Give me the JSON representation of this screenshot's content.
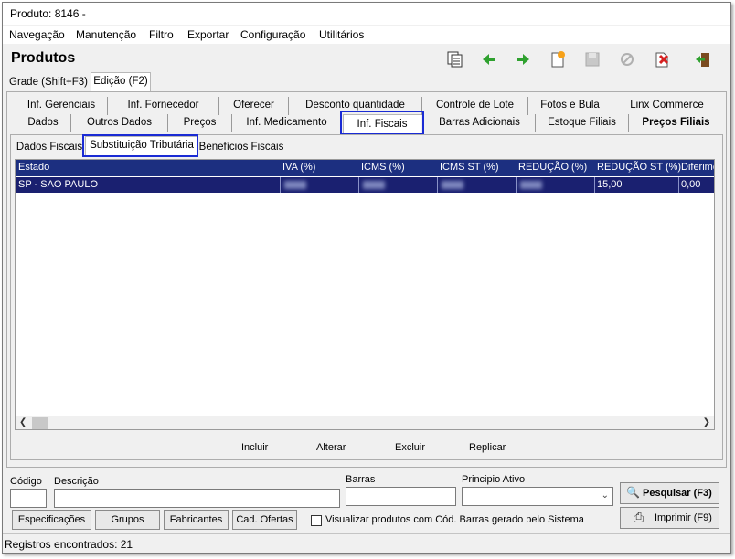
{
  "window": {
    "title_prefix": "Produto: 8146 -",
    "title_name": ""
  },
  "menu": [
    "Navegação",
    "Manutenção",
    "Filtro",
    "Exportar",
    "Configuração",
    "Utilitários"
  ],
  "header": {
    "title": "Produtos"
  },
  "toolbar": [
    "copy-icon",
    "arrow-left-icon",
    "arrow-right-icon",
    "new-icon",
    "save-icon",
    "cancel-icon",
    "delete-icon",
    "exit-icon"
  ],
  "view_tabs": [
    "Grade (Shift+F3)",
    "Edição (F2)"
  ],
  "tabs_row1": [
    "Inf. Gerenciais",
    "Inf. Fornecedor",
    "Oferecer",
    "Desconto quantidade",
    "Controle de Lote",
    "Fotos e Bula",
    "Linx Commerce"
  ],
  "tabs_row2": [
    "Dados",
    "Outros Dados",
    "Preços",
    "Inf. Medicamento",
    "Inf. Fiscais",
    "Barras Adicionais",
    "Estoque Filiais",
    "Preços Filiais"
  ],
  "subtabs": [
    "Dados Fiscais",
    "Substituição Tributária",
    "Benefícios Fiscais"
  ],
  "grid": {
    "columns": [
      "Estado",
      "IVA (%)",
      "ICMS (%)",
      "ICMS ST (%)",
      "REDUÇÃO (%)",
      "REDUÇÃO ST (%)",
      "Diferime"
    ],
    "rows": [
      {
        "estado": "SP - SAO PAULO",
        "iva": "",
        "icms": "",
        "icms_st": "",
        "reducao": "",
        "reducao_st": "15,00",
        "diferim": "0,00"
      }
    ]
  },
  "actions": [
    "Incluir",
    "Alterar",
    "Excluir",
    "Replicar"
  ],
  "search": {
    "labels": {
      "codigo": "Código",
      "descricao": "Descrição",
      "barras": "Barras",
      "principio": "Principio Ativo"
    },
    "buttons": [
      "Especificações",
      "Grupos",
      "Fabricantes",
      "Cad. Ofertas"
    ],
    "checkbox_label": "Visualizar produtos com Cód. Barras gerado pelo Sistema",
    "search_btn": "Pesquisar (F3)",
    "print_btn": "Imprimir (F9)"
  },
  "status": "Registros encontrados: 21"
}
